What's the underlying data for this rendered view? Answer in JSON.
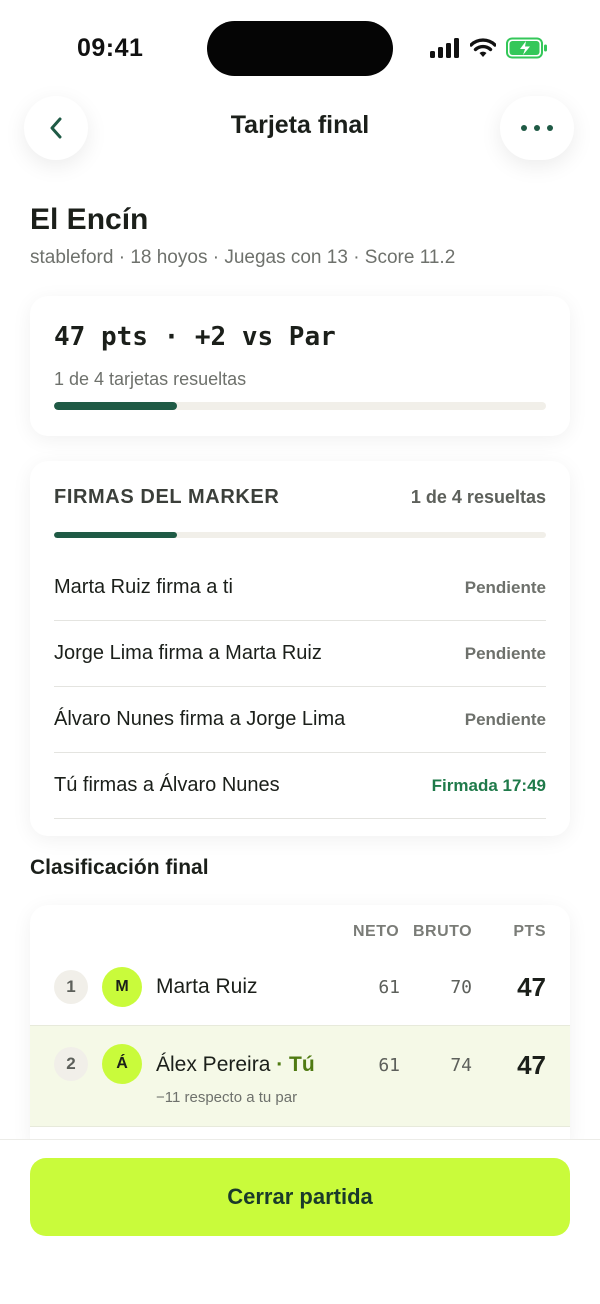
{
  "status_bar": {
    "time": "09:41"
  },
  "header": {
    "title": "Tarjeta final"
  },
  "course": {
    "name": "El Encín",
    "subtitle": "stableford · 18 hoyos · Juegas con 13 · Score 11.2"
  },
  "score": {
    "line": "47 pts · +2 vs Par",
    "progress_label": "1 de 4 tarjetas resueltas",
    "progress_fraction": 0.25
  },
  "marker": {
    "title": "FIRMAS DEL MARKER",
    "count": "1 de 4 resueltas",
    "progress_fraction": 0.25,
    "rows": [
      {
        "name": "Marta Ruiz firma a ti",
        "status": "Pendiente"
      },
      {
        "name": "Jorge Lima firma a Marta Ruiz",
        "status": "Pendiente"
      },
      {
        "name": "Álvaro Nunes firma a Jorge Lima",
        "status": "Pendiente"
      },
      {
        "name": "Tú firmas a Álvaro Nunes",
        "status": "Firmada 17:49"
      }
    ]
  },
  "ranking": {
    "title": "Clasificación final",
    "columns": {
      "neto": "NETO",
      "bruto": "BRUTO",
      "pts": "PTS"
    },
    "rows": [
      {
        "pos": "1",
        "initial": "M",
        "name": "Marta Ruiz",
        "neto": "61",
        "bruto": "70",
        "pts": "47"
      },
      {
        "pos": "2",
        "initial": "Á",
        "name": "Álex Pereira",
        "tag": "· Tú",
        "sub": "−11 respecto a tu par",
        "neto": "61",
        "bruto": "74",
        "pts": "47"
      }
    ]
  },
  "footer": {
    "close_label": "Cerrar partida"
  },
  "colors": {
    "accent": "#c9fb3b",
    "primary": "#1f5a45",
    "signed": "#1f7a4a"
  }
}
